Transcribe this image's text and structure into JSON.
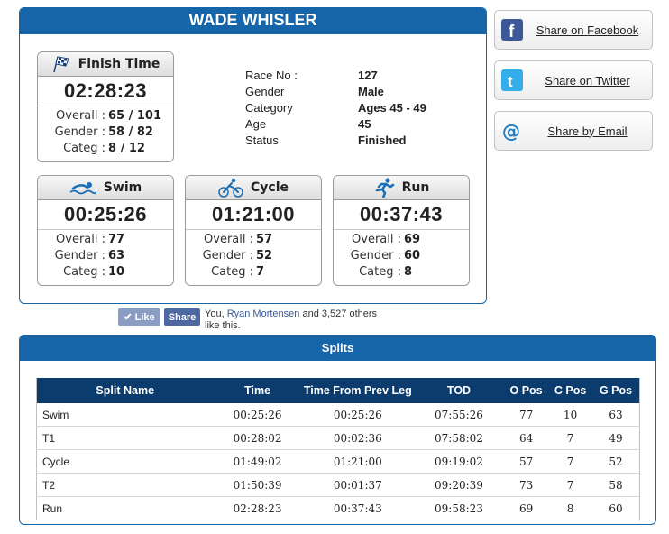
{
  "athlete": {
    "name": "WADE WHISLER"
  },
  "finish": {
    "title": "Finish Time",
    "time": "02:28:23",
    "rows": [
      {
        "label": "Overall :",
        "value": "65 / 101"
      },
      {
        "label": "Gender :",
        "value": "58 / 82"
      },
      {
        "label": "Categ :",
        "value": "8 / 12"
      }
    ]
  },
  "info": [
    {
      "key": "Race No :",
      "value": "127"
    },
    {
      "key": "Gender",
      "value": "Male"
    },
    {
      "key": "Category",
      "value": "Ages 45 - 49"
    },
    {
      "key": "Age",
      "value": "45"
    },
    {
      "key": "Status",
      "value": "Finished"
    }
  ],
  "legs": {
    "swim": {
      "title": "Swim",
      "time": "00:25:26",
      "rows": [
        {
          "label": "Overall :",
          "value": "77"
        },
        {
          "label": "Gender :",
          "value": "63"
        },
        {
          "label": "Categ :",
          "value": "10"
        }
      ]
    },
    "cycle": {
      "title": "Cycle",
      "time": "01:21:00",
      "rows": [
        {
          "label": "Overall :",
          "value": "57"
        },
        {
          "label": "Gender :",
          "value": "52"
        },
        {
          "label": "Categ :",
          "value": "7"
        }
      ]
    },
    "run": {
      "title": "Run",
      "time": "00:37:43",
      "rows": [
        {
          "label": "Overall :",
          "value": "69"
        },
        {
          "label": "Gender :",
          "value": "60"
        },
        {
          "label": "Categ :",
          "value": "8"
        }
      ]
    }
  },
  "share": {
    "facebook": "Share on Facebook",
    "twitter": "Share on Twitter",
    "email": "Share by Email"
  },
  "social": {
    "like_label": "Like",
    "share_label": "Share",
    "text_prefix": "You, ",
    "friend_name": "Ryan Mortensen",
    "text_suffix": " and 3,527 others like this."
  },
  "splits": {
    "title": "Splits",
    "columns": [
      "Split Name",
      "Time",
      "Time From Prev Leg",
      "TOD",
      "O Pos",
      "C Pos",
      "G Pos"
    ],
    "rows": [
      [
        "Swim",
        "00:25:26",
        "00:25:26",
        "07:55:26",
        "77",
        "10",
        "63"
      ],
      [
        "T1",
        "00:28:02",
        "00:02:36",
        "07:58:02",
        "64",
        "7",
        "49"
      ],
      [
        "Cycle",
        "01:49:02",
        "01:21:00",
        "09:19:02",
        "57",
        "7",
        "52"
      ],
      [
        "T2",
        "01:50:39",
        "00:01:37",
        "09:20:39",
        "73",
        "7",
        "58"
      ],
      [
        "Run",
        "02:28:23",
        "00:37:43",
        "09:58:23",
        "69",
        "8",
        "60"
      ]
    ]
  },
  "colors": {
    "brand_blue": "#1565a8",
    "table_header": "#0c3b6e",
    "facebook": "#3b5998"
  }
}
